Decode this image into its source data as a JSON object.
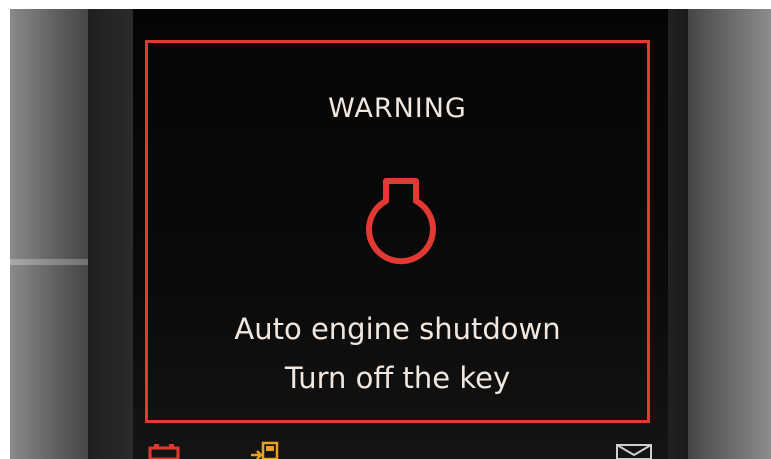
{
  "display": {
    "title": "WARNING",
    "message_line1": "Auto engine shutdown",
    "message_line2": "Turn off the key",
    "warning_icon": "engine-oil-pressure-warning-icon",
    "bottom_icons": [
      "battery-icon",
      "fuel-pump-icon",
      "message-envelope-icon"
    ]
  },
  "colors": {
    "frame": "#e23a33",
    "icon_red": "#e23a33",
    "icon_amber": "#e8a21c",
    "text": "#f2e7de",
    "screen_bg": "#050505"
  }
}
